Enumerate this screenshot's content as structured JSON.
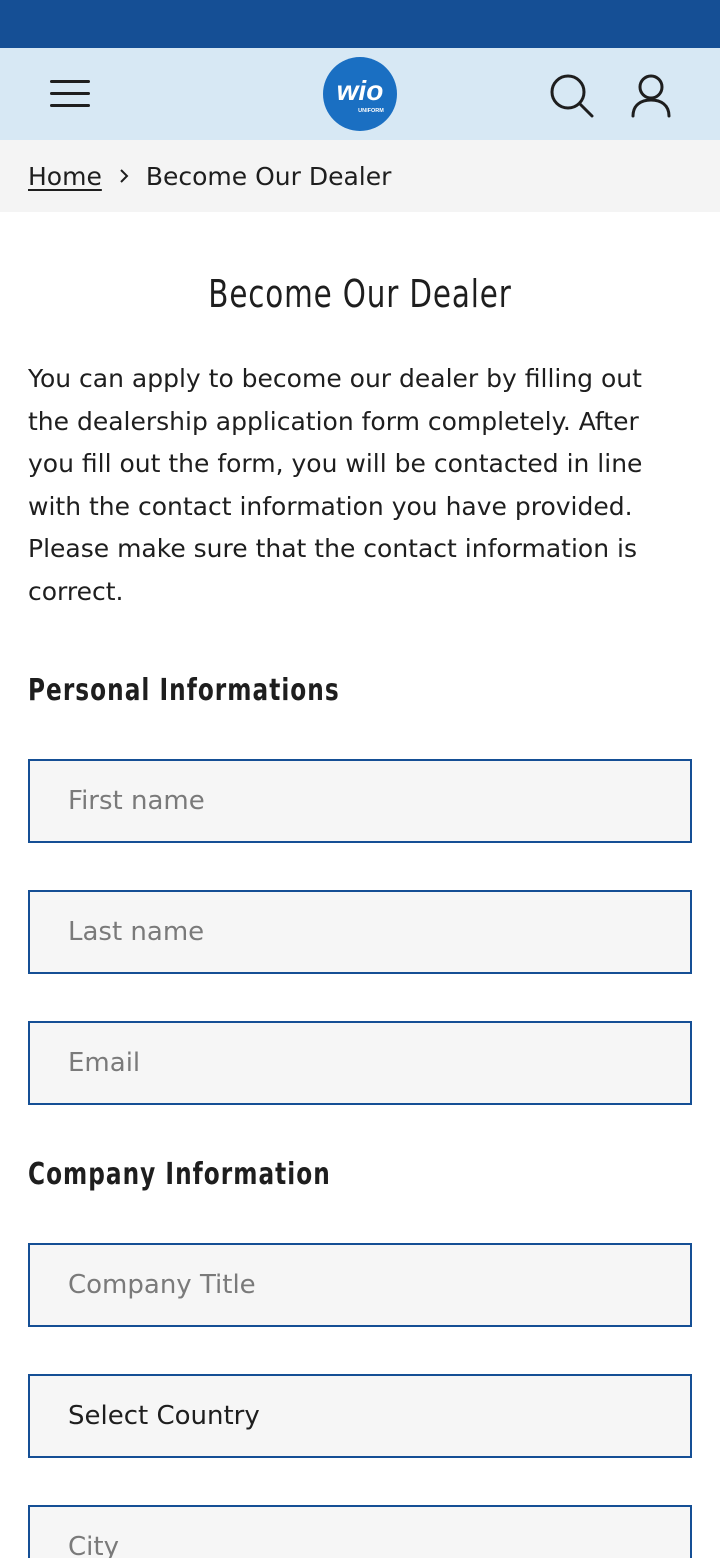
{
  "header": {
    "logo_text": "wio",
    "logo_subtext": "UNIFORM",
    "icons": [
      "menu-icon",
      "search-icon",
      "user-icon"
    ],
    "colors": {
      "top_bar": "#154f95",
      "header_bg": "#d7e8f4",
      "logo": "#1a6fc2"
    }
  },
  "breadcrumb": {
    "home": "Home",
    "separator_icon": "chevron-right-icon",
    "current": "Become Our Dealer"
  },
  "main": {
    "title": "Become Our Dealer",
    "intro": "You can apply to become our dealer by filling out the dealership application form completely. After you fill out the form, you will be contacted in line with the contact information you have provided. Please make sure that the contact information is correct.",
    "personal_section": {
      "title": "Personal Informations",
      "first_name_placeholder": "First name",
      "last_name_placeholder": "Last name",
      "email_placeholder": "Email"
    },
    "company_section": {
      "title": "Company Information",
      "company_title_placeholder": "Company Title",
      "country_select_value": "Select Country",
      "city_placeholder": "City"
    }
  }
}
